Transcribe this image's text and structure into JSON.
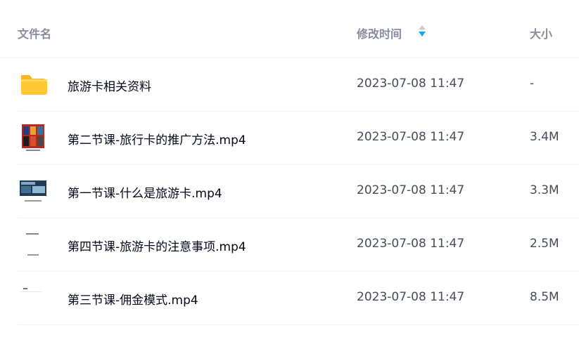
{
  "header": {
    "name_label": "文件名",
    "modified_label": "修改时间",
    "size_label": "大小"
  },
  "files": [
    {
      "name": "旅游卡相关资料",
      "modified": "2023-07-08 11:47",
      "size": "-",
      "icon": "folder-icon"
    },
    {
      "name": "第二节课-旅行卡的推广方法.mp4",
      "modified": "2023-07-08 11:47",
      "size": "3.4M",
      "icon": "video-thumbnail"
    },
    {
      "name": "第一节课-什么是旅游卡.mp4",
      "modified": "2023-07-08 11:47",
      "size": "3.3M",
      "icon": "video-thumbnail"
    },
    {
      "name": "第四节课-旅游卡的注意事项.mp4",
      "modified": "2023-07-08 11:47",
      "size": "2.5M",
      "icon": "video-thumbnail"
    },
    {
      "name": "第三节课-佣金模式.mp4",
      "modified": "2023-07-08 11:47",
      "size": "8.5M",
      "icon": "video-thumbnail"
    }
  ],
  "colors": {
    "header_text": "#878c9c",
    "name_text": "#03081a",
    "meta_text": "#454d5a",
    "sort_accent": "#06a7ff",
    "folder": "#ffc933",
    "divider": "#f1f2f4"
  }
}
